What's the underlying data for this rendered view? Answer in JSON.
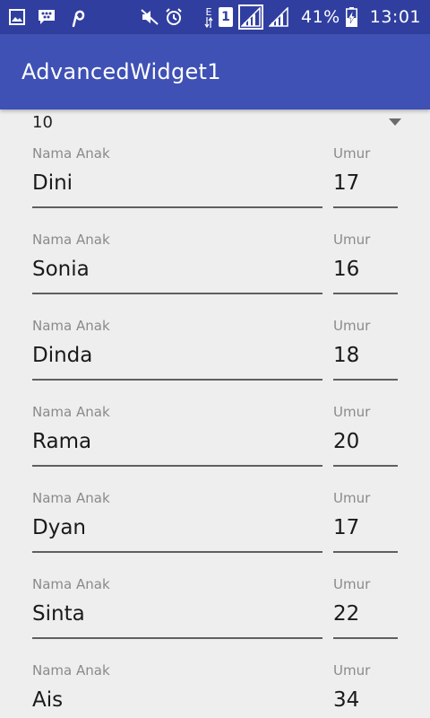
{
  "status_bar": {
    "battery_percent": "41%",
    "time": "13:01",
    "network_type": "E",
    "sim_slot": "1",
    "icons": [
      "gallery-icon",
      "bbm-icon",
      "pinterest-icon",
      "mute-icon",
      "alarm-icon",
      "data-arrows-icon",
      "sim-1-icon",
      "signal-1-icon",
      "signal-2-icon",
      "battery-charging-icon"
    ]
  },
  "app_bar": {
    "title": "AdvancedWidget1"
  },
  "spinner": {
    "selected": "10"
  },
  "list": {
    "name_label": "Nama Anak",
    "age_label": "Umur",
    "rows": [
      {
        "name": "Dini",
        "age": "17"
      },
      {
        "name": "Sonia",
        "age": "16"
      },
      {
        "name": "Dinda",
        "age": "18"
      },
      {
        "name": "Rama",
        "age": "20"
      },
      {
        "name": "Dyan",
        "age": "17"
      },
      {
        "name": "Sinta",
        "age": "22"
      },
      {
        "name": "Ais",
        "age": "34"
      }
    ]
  },
  "colors": {
    "status_bar": "#303f9f",
    "app_bar": "#3f51b5",
    "background": "#eeeeee",
    "underline": "#5f5f5f",
    "label": "#8a8a8a"
  }
}
